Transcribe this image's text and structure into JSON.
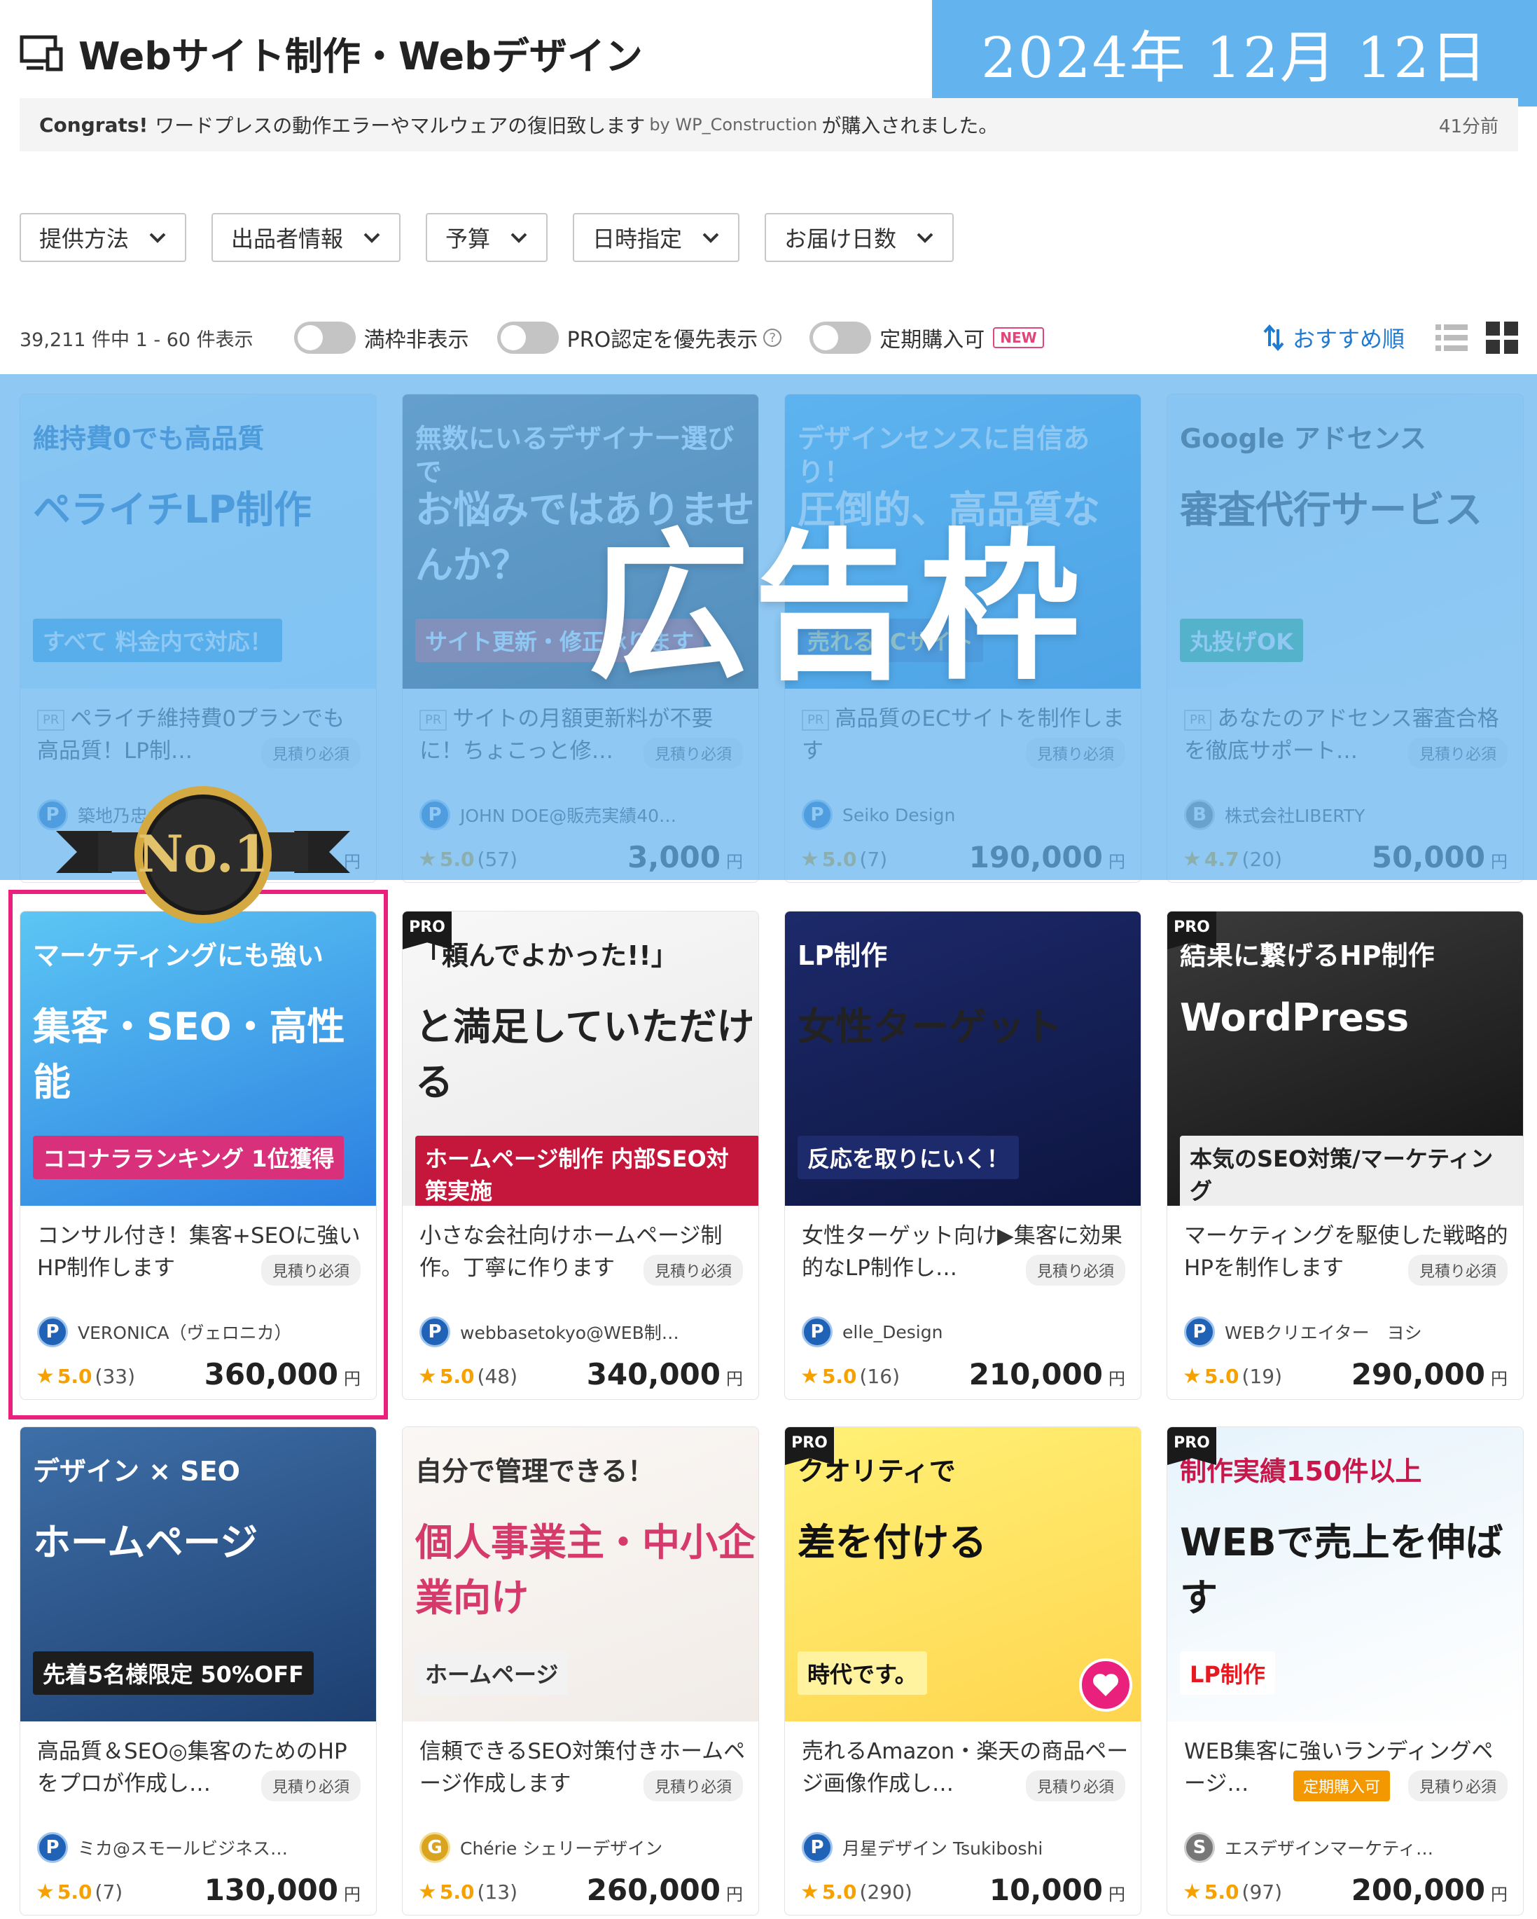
{
  "header": {
    "title": "Webサイト制作・Webデザイン",
    "date": "2024年 12月 12日"
  },
  "congrats": {
    "label": "Congrats!",
    "service": "ワードプレスの動作エラーやマルウェアの復旧致します",
    "by": "by WP_Construction",
    "suffix": "が購入されました。",
    "ago": "41分前"
  },
  "filters": [
    "提供方法",
    "出品者情報",
    "予算",
    "日時指定",
    "お届け日数"
  ],
  "results": {
    "count": "39,211 件中 1 - 60 件表示",
    "toggle1": "満枠非表示",
    "toggle2": "PRO認定を優先表示",
    "toggle3": "定期購入可",
    "new_badge": "NEW",
    "sort": "おすすめ順"
  },
  "ad_label": "広告枠",
  "no1_badge": "No.1",
  "yen": "円",
  "mitsumori": "見積り必須",
  "teiki_badge": "定期購入可",
  "pr_tag": "PR",
  "pro_tag": "PRO",
  "cards": [
    {
      "pr": true,
      "title": "ペライチ維持費0プランでも高品質！LP制…",
      "seller": "築地乃忠水…",
      "rating": "",
      "reviews": "",
      "price": "",
      "thumb_line1": "維持費0でも高品質",
      "thumb_line2": "ペライチLP制作",
      "thumb_line3": "すべて 料金内で対応！"
    },
    {
      "pr": true,
      "title": "サイトの月額更新料が不要に！ちょこっと修…",
      "seller": "JOHN DOE@販売実績40…",
      "rating": "5.0",
      "reviews": "(57)",
      "price": "3,000",
      "thumb_line1": "無数にいるデザイナー選びで",
      "thumb_line2": "お悩みではありませんか？",
      "thumb_line3": "サイト更新・修正承ります"
    },
    {
      "pr": true,
      "title": "高品質のECサイトを制作します",
      "seller": "Seiko Design",
      "rating": "5.0",
      "reviews": "(7)",
      "price": "190,000",
      "thumb_line1": "デザインセンスに自信あり！",
      "thumb_line2": "圧倒的、高品質な",
      "thumb_line3": "売れるECサイト"
    },
    {
      "pr": true,
      "title": "あなたのアドセンス審査合格を徹底サポート…",
      "seller": "株式会社LIBERTY",
      "rating": "4.7",
      "reviews": "(20)",
      "price": "50,000",
      "thumb_line1": "Google アドセンス",
      "thumb_line2": "審査代行サービス",
      "thumb_line3": "丸投げOK"
    },
    {
      "pr": false,
      "title": "コンサル付き！集客+SEOに強いHP制作します",
      "seller": "VERONICA（ヴェロニカ）",
      "rating": "5.0",
      "reviews": "(33)",
      "price": "360,000",
      "thumb_line1": "マーケティングにも強い",
      "thumb_line2": "集客・SEO・高性能",
      "thumb_line3": "ココナラランキング 1位獲得"
    },
    {
      "pr": false,
      "title": "小さな会社向けホームページ制作。丁寧に作ります",
      "seller": "webbasetokyo@WEB制…",
      "rating": "5.0",
      "reviews": "(48)",
      "price": "340,000",
      "thumb_line1": "「頼んでよかった!!」",
      "thumb_line2": "と満足していただける",
      "thumb_line3": "ホームページ制作 内部SEO対策実施"
    },
    {
      "pr": false,
      "title": "女性ターゲット向け▶集客に効果的なLP制作し…",
      "seller": "elle_Design",
      "rating": "5.0",
      "reviews": "(16)",
      "price": "210,000",
      "thumb_line1": "LP制作",
      "thumb_line2": "女性ターゲット",
      "thumb_line3": "反応を取りにいく！"
    },
    {
      "pr": false,
      "title": "マーケティングを駆使した戦略的HPを制作します",
      "seller": "WEBクリエイター　ヨシ",
      "rating": "5.0",
      "reviews": "(19)",
      "price": "290,000",
      "thumb_line1": "結果に繋げるHP制作",
      "thumb_line2": "WordPress",
      "thumb_line3": "本気のSEO対策/マーケティング"
    },
    {
      "pr": false,
      "title": "高品質＆SEO◎集客のためのHPをプロが作成し…",
      "seller": "ミカ@スモールビジネス…",
      "rating": "5.0",
      "reviews": "(7)",
      "price": "130,000",
      "thumb_line1": "デザイン × SEO",
      "thumb_line2": "ホームページ",
      "thumb_line3": "先着5名様限定 50%OFF"
    },
    {
      "pr": false,
      "title": "信頼できるSEO対策付きホームページ作成します",
      "seller": "Chérie シェリーデザイン",
      "rating": "5.0",
      "reviews": "(13)",
      "price": "260,000",
      "thumb_line1": "自分で管理できる！",
      "thumb_line2": "個人事業主・中小企業向け",
      "thumb_line3": "ホームページ"
    },
    {
      "pr": false,
      "title": "売れるAmazon・楽天の商品ページ画像作成し…",
      "seller": "月星デザイン Tsukiboshi",
      "rating": "5.0",
      "reviews": "(290)",
      "price": "10,000",
      "thumb_line1": "クオリティで",
      "thumb_line2": "差を付ける",
      "thumb_line3": "時代です。"
    },
    {
      "pr": false,
      "title": "WEB集客に強いランディングページ…",
      "seller": "エスデザインマーケティ…",
      "rating": "5.0",
      "reviews": "(97)",
      "price": "200,000",
      "thumb_line1": "制作実績150件以上",
      "thumb_line2": "WEBで売上を伸ばす",
      "thumb_line3": "LP制作"
    }
  ],
  "colors": {
    "accent": "#1f7bd1",
    "ad_overlay": "#62b3ee",
    "highlight": "#e9217d",
    "star": "#f6a100"
  }
}
